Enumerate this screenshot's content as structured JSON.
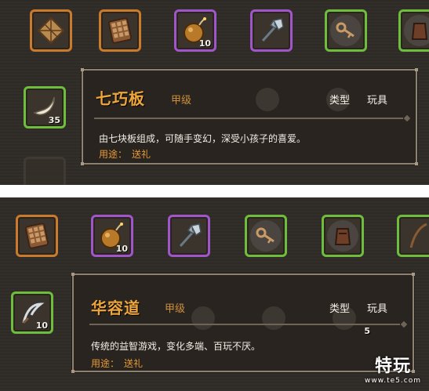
{
  "panel1": {
    "slots_top": [
      {
        "icon": "tangram-icon",
        "border": "#c97a2a",
        "count": ""
      },
      {
        "icon": "tangram-board-icon",
        "border": "#c97a2a",
        "count": ""
      },
      {
        "icon": "gourd-bomb-icon",
        "border": "#a055c8",
        "count": "10"
      },
      {
        "icon": "axe-icon",
        "border": "#a055c8",
        "count": ""
      },
      {
        "icon": "key-icon",
        "border": "#6fbd3c",
        "count": ""
      },
      {
        "icon": "armor-icon",
        "border": "#6fbd3c",
        "count": ""
      }
    ],
    "slot_left": {
      "icon": "horn-icon",
      "border": "#6fbd3c",
      "count": "35"
    },
    "tooltip": {
      "name": "七巧板",
      "grade": "甲级",
      "type_label": "类型",
      "type_value": "玩具",
      "description": "由七块板组成，可随手变幻，深受小孩子的喜爱。",
      "use_label": "用途：",
      "use_value": "送礼"
    }
  },
  "panel2": {
    "slots_top": [
      {
        "icon": "tangram-board-icon",
        "border": "#c97a2a",
        "count": ""
      },
      {
        "icon": "gourd-bomb-icon",
        "border": "#a055c8",
        "count": "10"
      },
      {
        "icon": "axe-icon",
        "border": "#a055c8",
        "count": ""
      },
      {
        "icon": "key-icon",
        "border": "#6fbd3c",
        "count": ""
      },
      {
        "icon": "armor-icon",
        "border": "#6fbd3c",
        "count": ""
      },
      {
        "icon": "bow-icon",
        "border": "#6fbd3c",
        "count": ""
      }
    ],
    "slot_left": {
      "icon": "sickle-icon",
      "border": "#6fbd3c",
      "count": "10"
    },
    "tooltip": {
      "name": "华容道",
      "grade": "甲级",
      "type_label": "类型",
      "type_value": "玩具",
      "description": "传统的益智游戏，变化多端、百玩不厌。",
      "use_label": "用途：",
      "use_value": "送礼"
    },
    "ghost_count": "5"
  },
  "watermark": {
    "text": "特玩",
    "sub": "www.te5.com"
  }
}
